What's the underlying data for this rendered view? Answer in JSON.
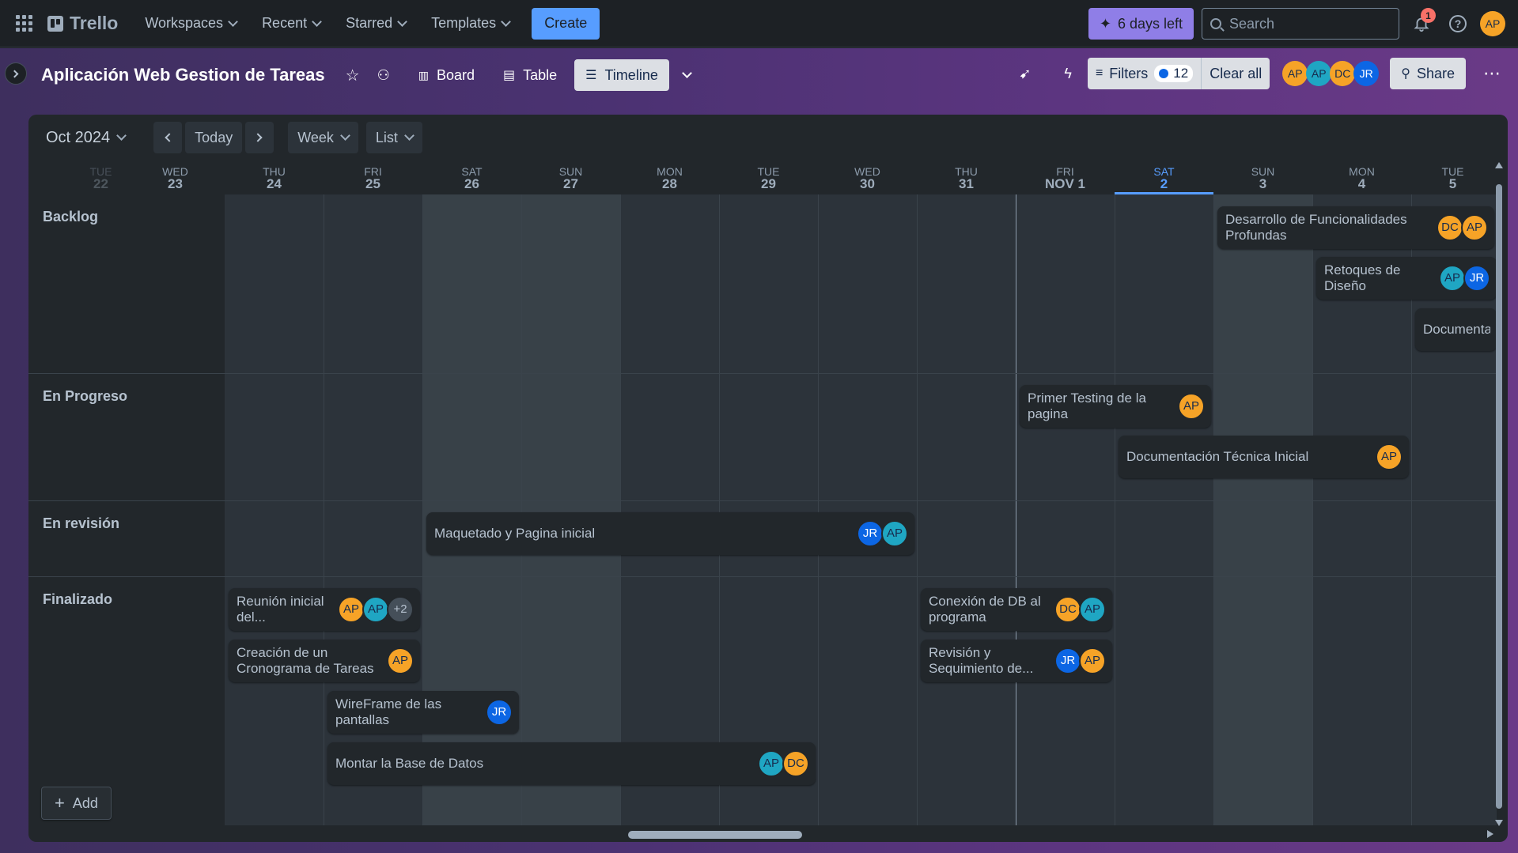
{
  "topbar": {
    "app_name": "Trello",
    "nav": [
      "Workspaces",
      "Recent",
      "Starred",
      "Templates"
    ],
    "create_label": "Create",
    "trial_label": "6 days left",
    "search_placeholder": "Search",
    "notification_count": "1",
    "user_initials": "AP",
    "colors": {
      "accent": "#579dff",
      "trial": "#8f7ee7",
      "badge": "#f87168"
    }
  },
  "board": {
    "title": "Aplicación Web Gestion de Tareas",
    "views": [
      {
        "label": "Board",
        "active": false
      },
      {
        "label": "Table",
        "active": false
      },
      {
        "label": "Timeline",
        "active": true
      }
    ],
    "filters_label": "Filters",
    "filter_count": "12",
    "clear_label": "Clear all",
    "members": [
      "AP",
      "AP",
      "DC",
      "JR"
    ],
    "share_label": "Share",
    "icons": [
      "star-icon",
      "workspace-visibility-icon",
      "power-ups-icon",
      "automation-icon",
      "more-icon"
    ]
  },
  "timeline": {
    "month_label": "Oct 2024",
    "today_label": "Today",
    "range_label": "Week",
    "group_label": "List",
    "days": [
      {
        "dow": "TUE",
        "num": "22"
      },
      {
        "dow": "WED",
        "num": "23"
      },
      {
        "dow": "THU",
        "num": "24"
      },
      {
        "dow": "FRI",
        "num": "25"
      },
      {
        "dow": "SAT",
        "num": "26"
      },
      {
        "dow": "SUN",
        "num": "27"
      },
      {
        "dow": "MON",
        "num": "28"
      },
      {
        "dow": "TUE",
        "num": "29"
      },
      {
        "dow": "WED",
        "num": "30"
      },
      {
        "dow": "THU",
        "num": "31"
      },
      {
        "dow": "FRI",
        "num": "NOV 1"
      },
      {
        "dow": "SAT",
        "num": "2"
      },
      {
        "dow": "SUN",
        "num": "3"
      },
      {
        "dow": "MON",
        "num": "4"
      },
      {
        "dow": "TUE",
        "num": "5"
      }
    ],
    "today_index": 11,
    "lanes": [
      {
        "label": "Backlog"
      },
      {
        "label": "En Progreso"
      },
      {
        "label": "En revisión"
      },
      {
        "label": "Finalizado"
      }
    ],
    "add_label": "Add",
    "cards": {
      "c1": {
        "title": "Desarrollo de Funcionalidades Profundas",
        "avatars": [
          "DC",
          "AP"
        ]
      },
      "c2": {
        "title": "Retoques de Diseño",
        "avatars": [
          "AP",
          "JR"
        ]
      },
      "c3": {
        "title": "Documenta",
        "avatars": []
      },
      "c4": {
        "title": "Primer Testing de la pagina",
        "avatars": [
          "AP"
        ]
      },
      "c5": {
        "title": "Documentación Técnica Inicial",
        "avatars": [
          "AP"
        ]
      },
      "c6": {
        "title": "Maquetado y Pagina inicial",
        "avatars": [
          "JR",
          "AP"
        ]
      },
      "c7": {
        "title": "Reunión inicial del...",
        "avatars": [
          "AP",
          "AP",
          "+2"
        ]
      },
      "c8": {
        "title": "Creación de un Cronograma de Tareas",
        "avatars": [
          "AP"
        ]
      },
      "c9": {
        "title": "WireFrame de las pantallas",
        "avatars": [
          "JR"
        ]
      },
      "c10": {
        "title": "Montar la Base de Datos",
        "avatars": [
          "AP",
          "DC"
        ]
      },
      "c11": {
        "title": "Conexión de DB al programa",
        "avatars": [
          "DC",
          "AP"
        ]
      },
      "c12": {
        "title": "Revisión y Sequimiento de...",
        "avatars": [
          "JR",
          "AP"
        ]
      }
    }
  }
}
